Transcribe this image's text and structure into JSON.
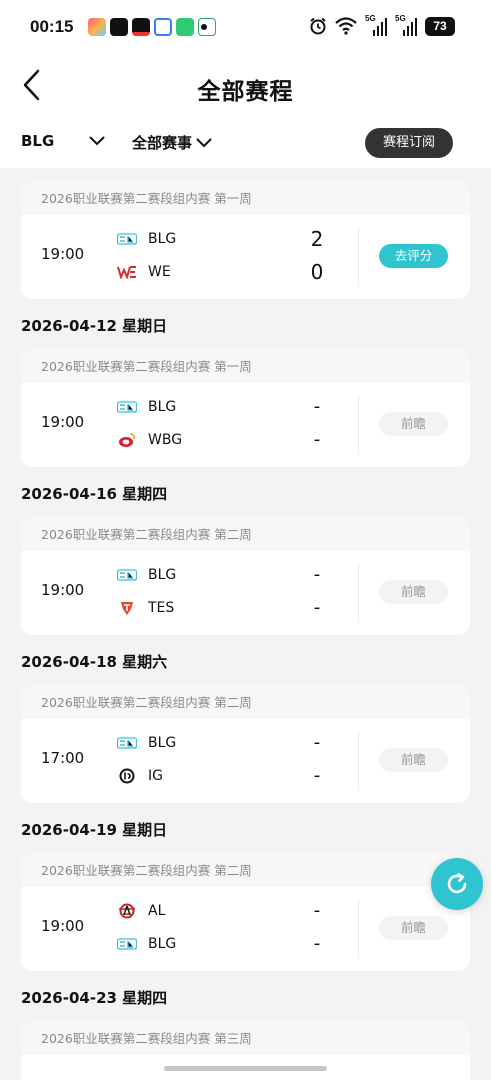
{
  "status_bar": {
    "time": "00:15",
    "network_1": "5G",
    "network_2": "5G",
    "battery": "73"
  },
  "header": {
    "title": "全部赛程"
  },
  "filters": {
    "team": "BLG",
    "event": "全部赛事",
    "subscribe_label": "赛程订阅"
  },
  "matches": [
    {
      "date": "",
      "stage": "2026职业联赛第二赛段组内赛 第一周",
      "time": "19:00",
      "team1": "BLG",
      "team1_logo": "blg-logo-icon",
      "team2": "WE",
      "team2_logo": "we-logo-icon",
      "score1": "2",
      "score2": "0",
      "action": "去评分"
    },
    {
      "date": "2026-04-12 星期日",
      "stage": "2026职业联赛第二赛段组内赛 第一周",
      "time": "19:00",
      "team1": "BLG",
      "team1_logo": "blg-logo-icon",
      "team2": "WBG",
      "team2_logo": "wbg-logo-icon",
      "score1": "-",
      "score2": "-",
      "action": "前瞻"
    },
    {
      "date": "2026-04-16 星期四",
      "stage": "2026职业联赛第二赛段组内赛 第二周",
      "time": "19:00",
      "team1": "BLG",
      "team1_logo": "blg-logo-icon",
      "team2": "TES",
      "team2_logo": "tes-logo-icon",
      "score1": "-",
      "score2": "-",
      "action": "前瞻"
    },
    {
      "date": "2026-04-18 星期六",
      "stage": "2026职业联赛第二赛段组内赛 第二周",
      "time": "17:00",
      "team1": "BLG",
      "team1_logo": "blg-logo-icon",
      "team2": "IG",
      "team2_logo": "ig-logo-icon",
      "score1": "-",
      "score2": "-",
      "action": "前瞻"
    },
    {
      "date": "2026-04-19 星期日",
      "stage": "2026职业联赛第二赛段组内赛 第二周",
      "time": "19:00",
      "team1": "AL",
      "team1_logo": "al-logo-icon",
      "team2": "BLG",
      "team2_logo": "blg-logo-icon",
      "score1": "-",
      "score2": "-",
      "action": "前瞻"
    },
    {
      "date": "2026-04-23 星期四",
      "stage": "2026职业联赛第二赛段组内赛 第三周"
    }
  ],
  "colors": {
    "accent": "#2ec4d0",
    "subscribe_bg": "#333333",
    "page_bg": "#f3f3f3"
  }
}
